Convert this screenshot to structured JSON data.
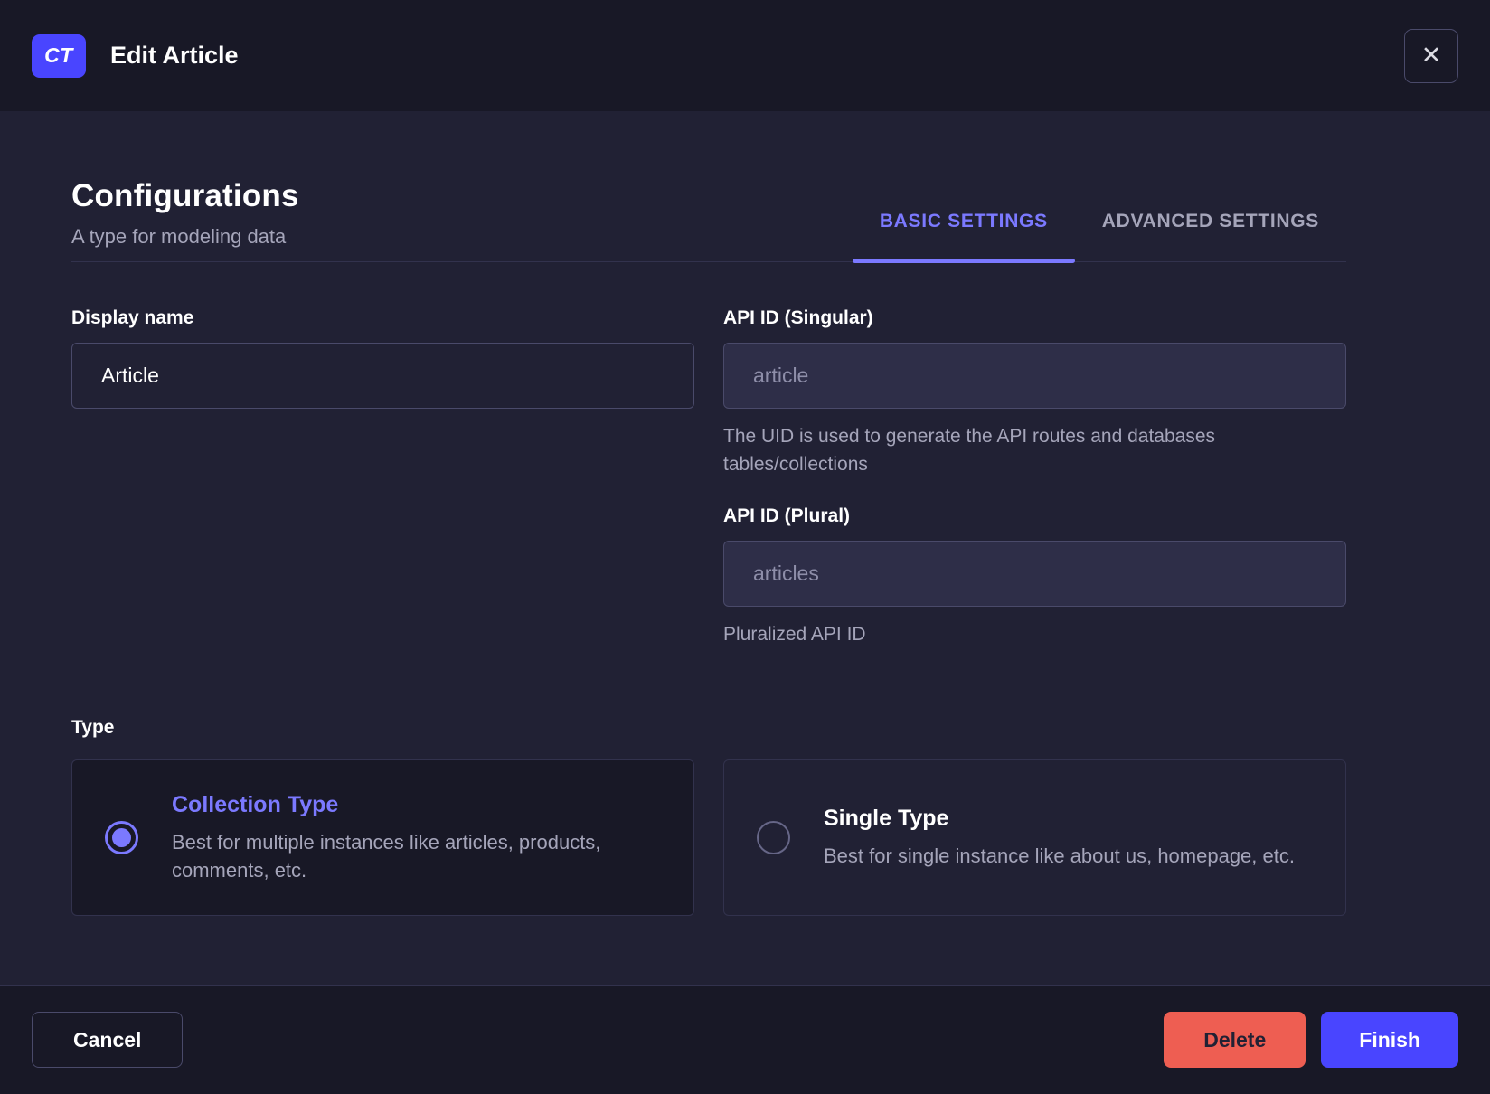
{
  "header": {
    "badge": "CT",
    "title": "Edit Article",
    "close_icon": "✕"
  },
  "config": {
    "title": "Configurations",
    "subtitle": "A type for modeling data",
    "tabs": [
      {
        "label": "BASIC SETTINGS",
        "active": true
      },
      {
        "label": "ADVANCED SETTINGS",
        "active": false
      }
    ]
  },
  "fields": {
    "display_name": {
      "label": "Display name",
      "value": "Article"
    },
    "api_id_singular": {
      "label": "API ID (Singular)",
      "placeholder": "article",
      "hint": "The UID is used to generate the API routes and databases tables/collections"
    },
    "api_id_plural": {
      "label": "API ID (Plural)",
      "placeholder": "articles",
      "hint": "Pluralized API ID"
    }
  },
  "type": {
    "label": "Type",
    "options": [
      {
        "title": "Collection Type",
        "description": "Best for multiple instances like articles, products, comments, etc.",
        "selected": true
      },
      {
        "title": "Single Type",
        "description": "Best for single instance like about us, homepage, etc.",
        "selected": false
      }
    ]
  },
  "footer": {
    "cancel_label": "Cancel",
    "delete_label": "Delete",
    "finish_label": "Finish"
  },
  "colors": {
    "primary": "#4945ff",
    "primary_light": "#7b79ff",
    "danger": "#ee5e52",
    "bg_dark": "#181826",
    "bg_body": "#212134",
    "text_muted": "#a5a5ba"
  }
}
